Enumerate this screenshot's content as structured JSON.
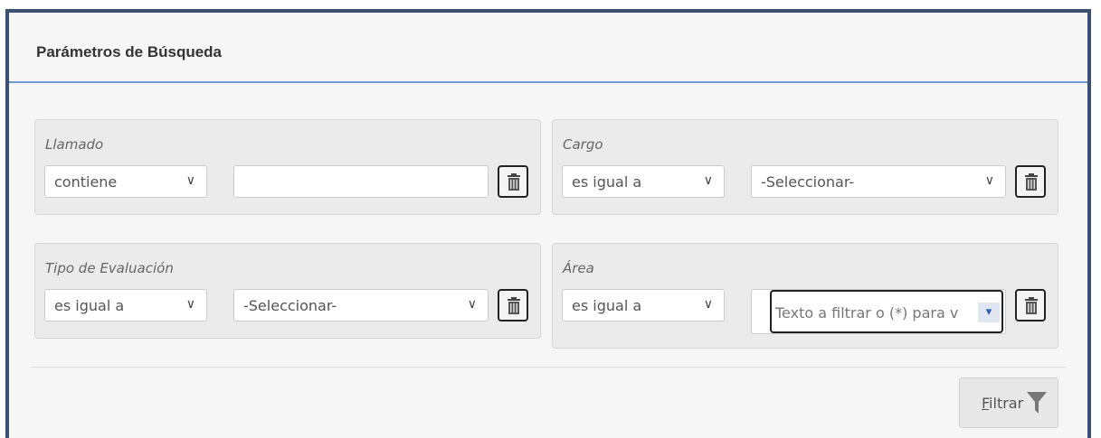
{
  "panel": {
    "title": "Parámetros de Búsqueda"
  },
  "filters": {
    "llamado": {
      "label": "Llamado",
      "operator": "contiene",
      "value": ""
    },
    "cargo": {
      "label": "Cargo",
      "operator": "es igual a",
      "value": "-Seleccionar-"
    },
    "tipo_evaluacion": {
      "label": "Tipo de Evaluación",
      "operator": "es igual a",
      "value": "-Seleccionar-"
    },
    "area": {
      "label": "Área",
      "operator": "es igual a",
      "placeholder": "Texto a filtrar o (*) para v"
    }
  },
  "actions": {
    "filter_label_first": "F",
    "filter_label_rest": "iltrar"
  },
  "icons": {
    "delete": "trash-icon",
    "dropdown": "chevron-down-icon",
    "filter": "funnel-icon"
  },
  "colors": {
    "frame": "#3c5171",
    "header_rule": "#6f9bd1",
    "card_bg": "#ebebeb"
  }
}
